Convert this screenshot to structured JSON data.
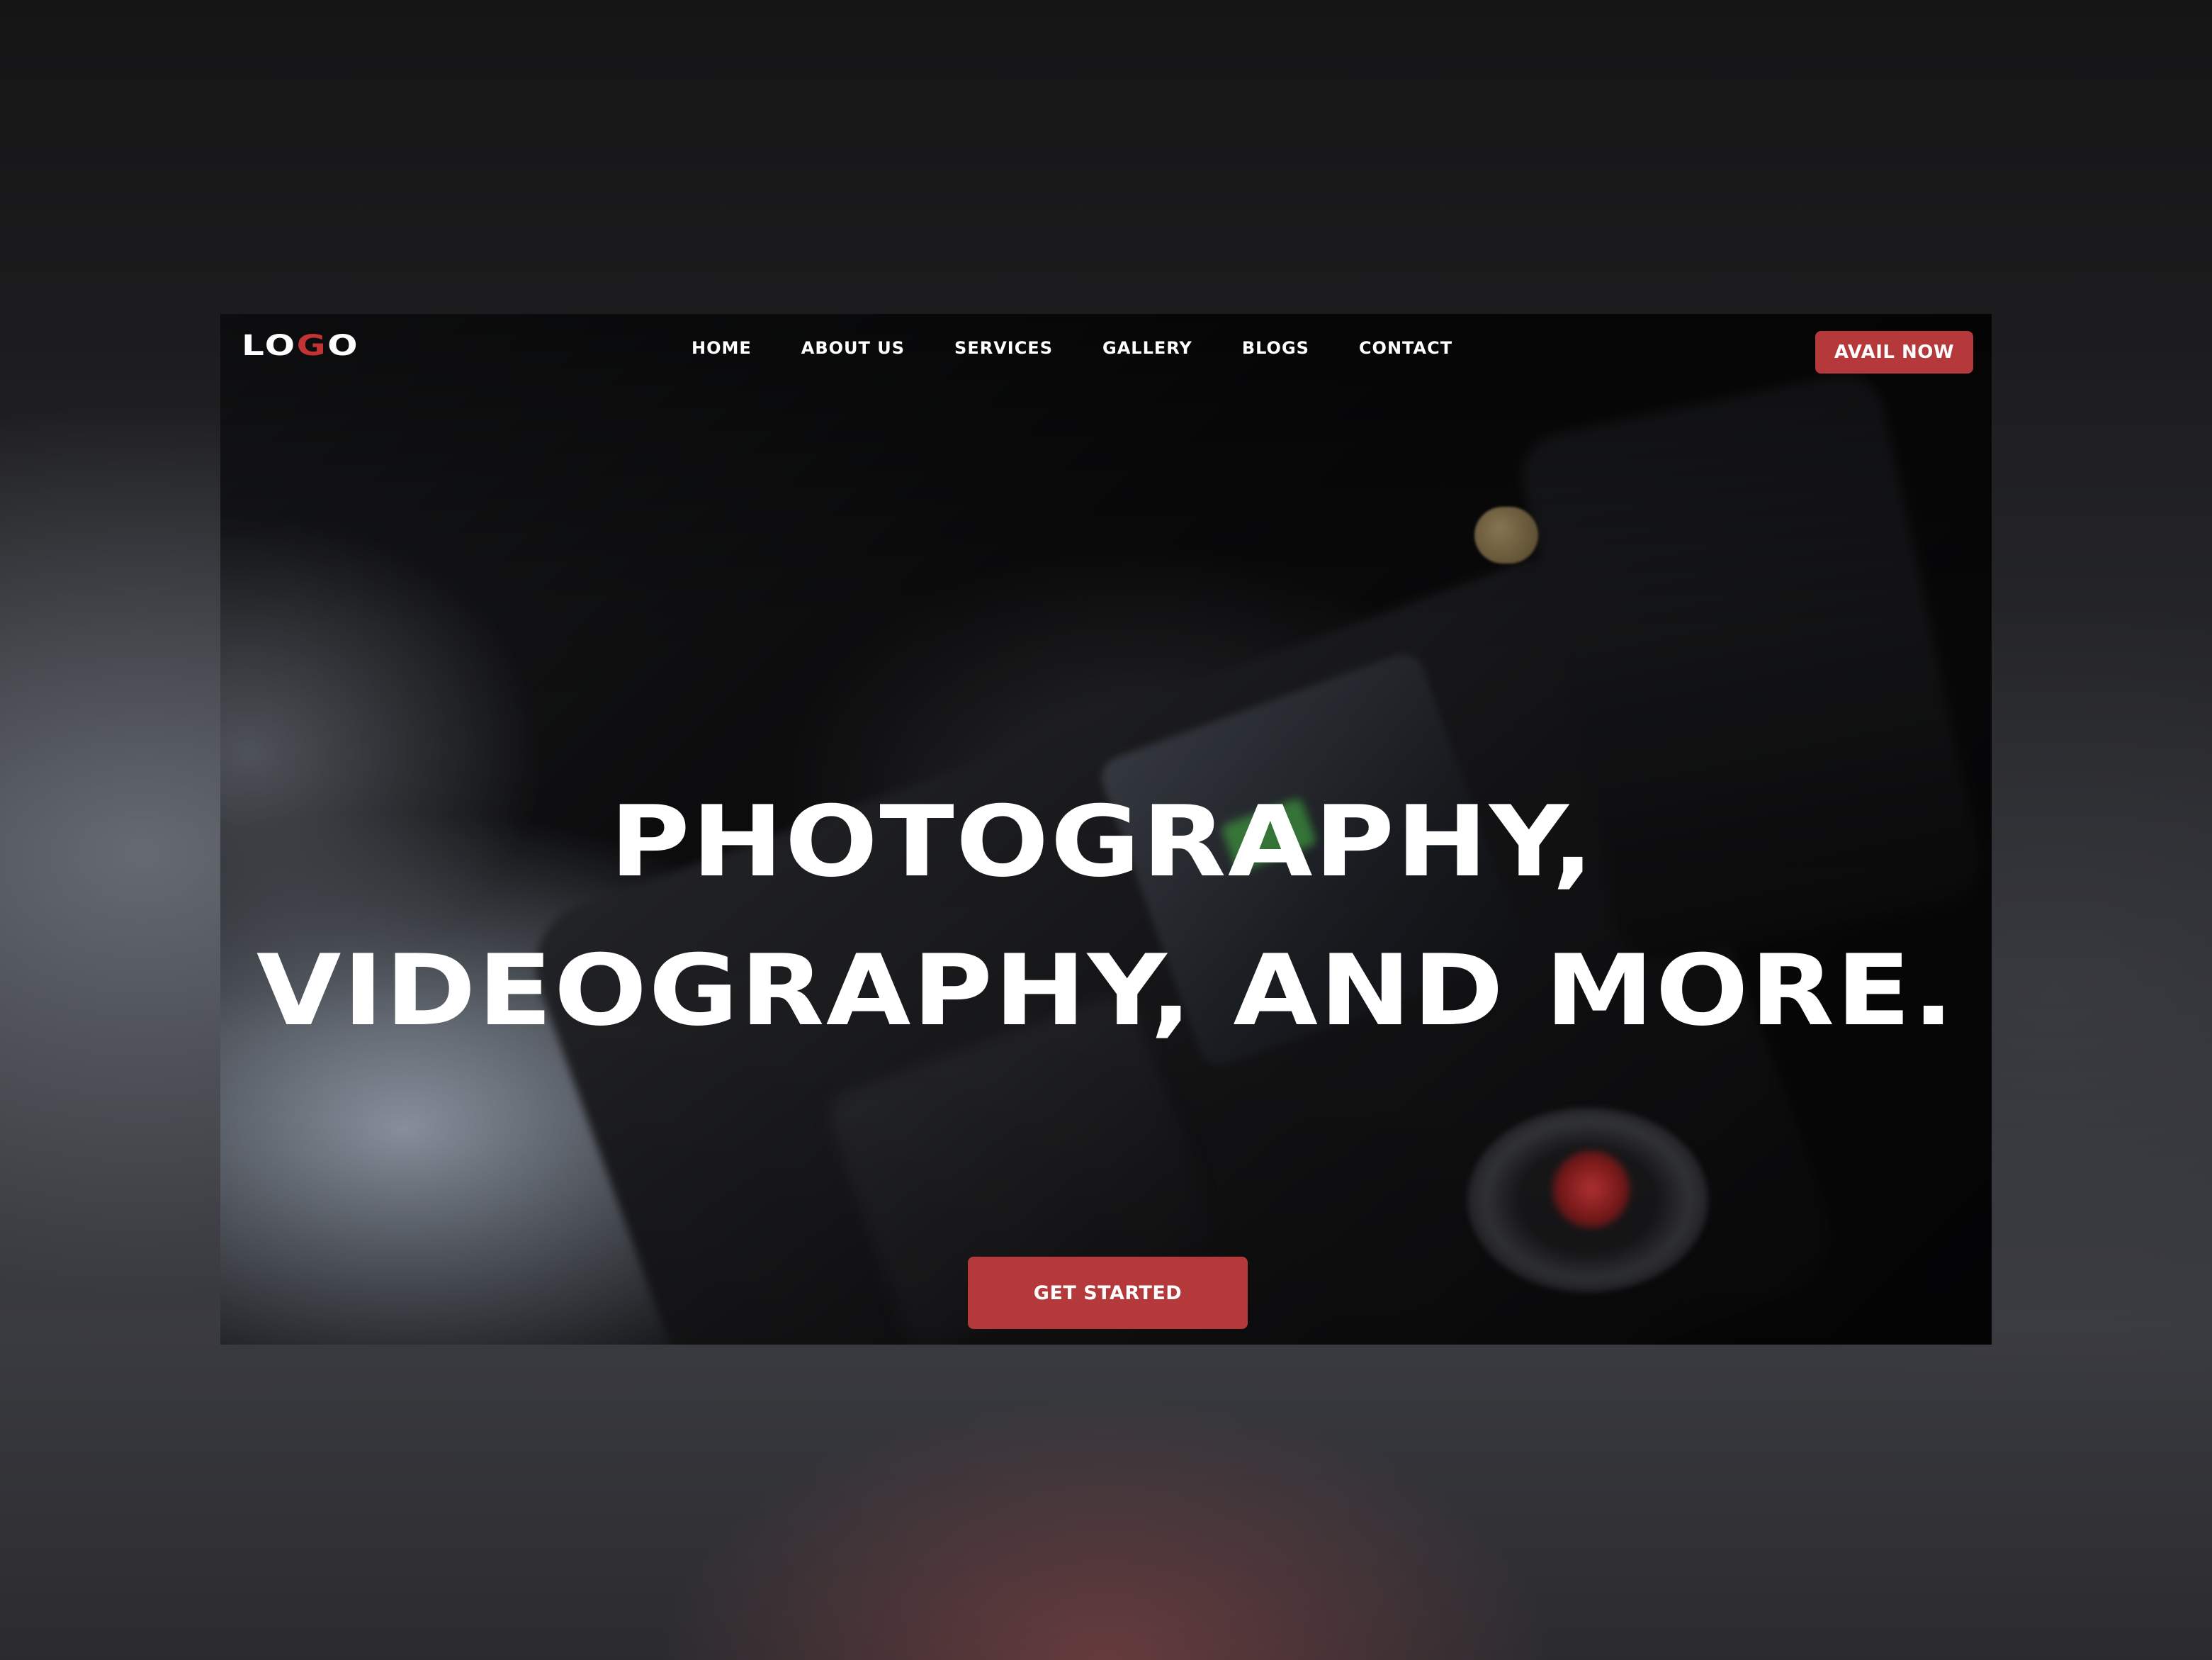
{
  "header": {
    "logo_part1": "LO",
    "logo_accent": "G",
    "logo_part2": "O",
    "nav": [
      {
        "label": "HOME"
      },
      {
        "label": "ABOUT US"
      },
      {
        "label": "SERVICES"
      },
      {
        "label": "GALLERY"
      },
      {
        "label": "BLOGS"
      },
      {
        "label": "CONTACT"
      }
    ],
    "cta_label": "AVAIL NOW"
  },
  "hero": {
    "headline_line1": "PHOTOGRAPHY,",
    "headline_line2": "VIDEOGRAPHY, AND MORE.",
    "cta_label": "GET STARTED"
  },
  "colors": {
    "accent": "#b5383a",
    "text": "#ffffff",
    "background": "#050506"
  }
}
